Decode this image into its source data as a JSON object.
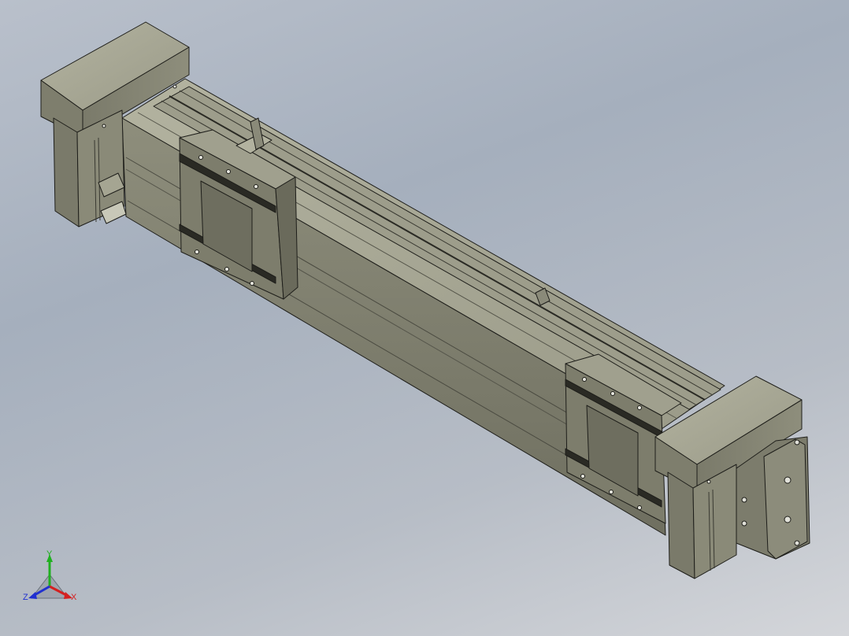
{
  "viewport": {
    "background_top": "#a5afbd",
    "background_bottom": "#d4d6da"
  },
  "model": {
    "body_color": "#8a8a78",
    "top_color": "#a7a794",
    "dark_color": "#5e5e50",
    "edge_color": "#1e1e1a"
  },
  "triad": {
    "x_label": "X",
    "y_label": "Y",
    "z_label": "Z",
    "x_color": "#d42020",
    "y_color": "#20b020",
    "z_color": "#2030d0"
  }
}
